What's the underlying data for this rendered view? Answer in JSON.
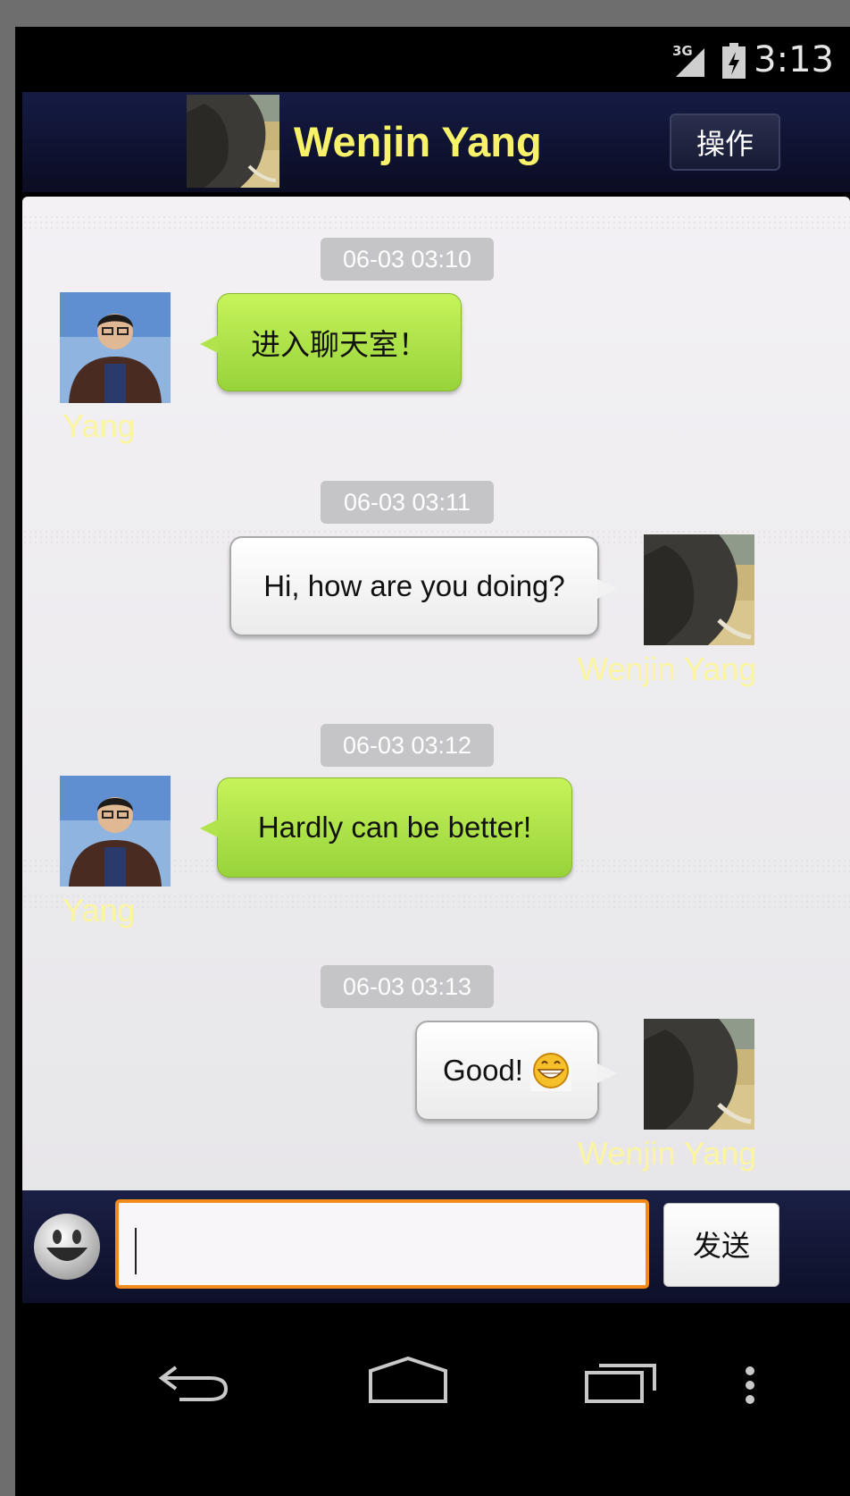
{
  "status_bar": {
    "network": "3G",
    "time": "3:13"
  },
  "header": {
    "title": "Wenjin Yang",
    "action_label": "操作"
  },
  "messages": [
    {
      "time": "06-03 03:10",
      "sender": "Yang",
      "text": "进入聊天室！",
      "side": "left"
    },
    {
      "time": "06-03 03:11",
      "sender": "Wenjin Yang",
      "text": "Hi, how are you doing?",
      "side": "right"
    },
    {
      "time": "06-03 03:12",
      "sender": "Yang",
      "text": "Hardly can be better!",
      "side": "left"
    },
    {
      "time": "06-03 03:13",
      "sender": "Wenjin Yang",
      "text": "Good!",
      "side": "right",
      "emoji": "grinning-face-emoji"
    }
  ],
  "composer": {
    "value": "",
    "send_label": "发送"
  },
  "colors": {
    "accent_orange": "#f58a1c",
    "name_yellow": "#f7f26a",
    "bubble_green": "#b0e44a",
    "header_navy": "#151b45"
  }
}
